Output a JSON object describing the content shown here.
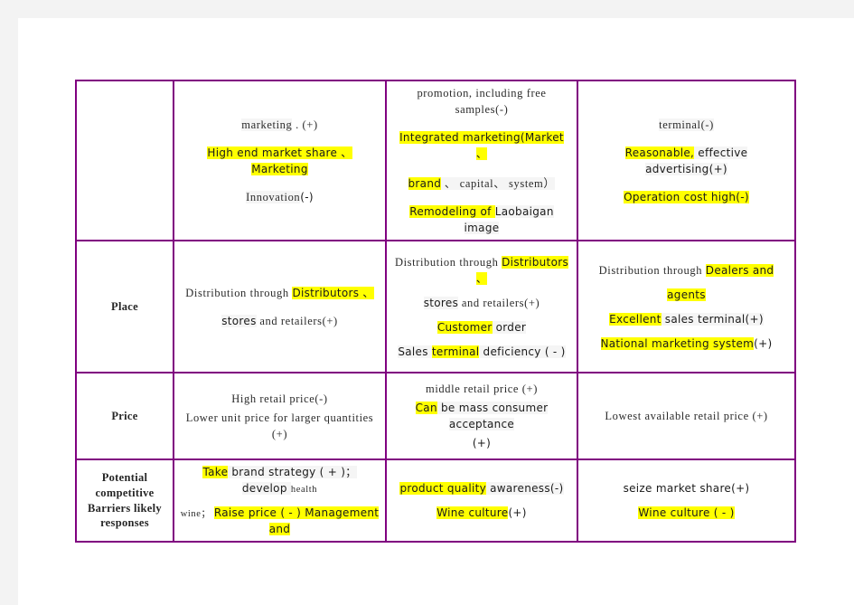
{
  "document": {
    "type": "marketing-mix-comparison-matrix",
    "border_color": "#800080",
    "highlight_color": "#ffff00",
    "page_background": "#ffffff",
    "margin_band_color": "#f3f3f3"
  },
  "table": {
    "row_labels": {
      "r1": "",
      "r2": "Place",
      "r3": "Price",
      "r4": "Potential competitive Barriers likely responses"
    },
    "rows": [
      {
        "label": "",
        "label_lines": [],
        "col1": {
          "lines": [
            [
              {
                "t": "marketing",
                "hl": false,
                "f": "serif",
                "bg": true
              },
              {
                "t": " . (+)",
                "hl": false,
                "f": "serif"
              }
            ],
            [
              {
                "t": "High end market share 、Marketing",
                "hl": true,
                "f": "sans"
              }
            ],
            [
              {
                "t": "Innovation",
                "hl": false,
                "f": "serif",
                "bg": true
              },
              {
                "t": "(-)",
                "hl": false,
                "f": "sans"
              }
            ]
          ]
        },
        "col2": {
          "lines": [
            [
              {
                "t": "promotion, including free samples(-)",
                "hl": false,
                "f": "serif"
              }
            ],
            [
              {
                "t": "Integrated marketing(Market   、",
                "hl": true,
                "f": "sans"
              }
            ],
            [
              {
                "t": "brand",
                "hl": true,
                "f": "sans"
              },
              {
                "t": " 、 capital、 system）",
                "hl": false,
                "f": "serif",
                "bg": true
              }
            ],
            [
              {
                "t": "Remodeling of ",
                "hl": true,
                "f": "sans"
              },
              {
                "t": "Laobaigan image",
                "hl": false,
                "f": "sans",
                "bg": true
              }
            ]
          ]
        },
        "col3": {
          "lines": [
            [
              {
                "t": "terminal(-)",
                "hl": false,
                "f": "serif",
                "bg": true
              }
            ],
            [
              {
                "t": "Reasonable,",
                "hl": true,
                "f": "sans"
              },
              {
                "t": " effective advertising(+)",
                "hl": false,
                "f": "sans",
                "bg": true
              }
            ],
            [
              {
                "t": "Operation cost high(-)",
                "hl": true,
                "f": "sans"
              }
            ]
          ]
        }
      },
      {
        "label": "Place",
        "label_lines": [
          "Place"
        ],
        "col1": {
          "lines": [
            [
              {
                "t": "Distribution through ",
                "hl": false,
                "f": "serif"
              },
              {
                "t": "Distributors  、",
                "hl": true,
                "f": "sans"
              }
            ],
            [
              {
                "t": "stores",
                "hl": false,
                "f": "sans",
                "bg": true
              },
              {
                "t": " and retailers(+)",
                "hl": false,
                "f": "serif"
              }
            ]
          ]
        },
        "col2": {
          "lines": [
            [
              {
                "t": "Distribution through ",
                "hl": false,
                "f": "serif"
              },
              {
                "t": "Distributors  、",
                "hl": true,
                "f": "sans"
              }
            ],
            [
              {
                "t": "stores",
                "hl": false,
                "f": "sans",
                "bg": true
              },
              {
                "t": " and retailers(+)",
                "hl": false,
                "f": "serif"
              }
            ],
            [
              {
                "t": "Customer",
                "hl": true,
                "f": "sans"
              },
              {
                "t": " order",
                "hl": false,
                "f": "sans",
                "bg": true
              }
            ],
            [
              {
                "t": "Sales ",
                "hl": false,
                "f": "sans",
                "bg": true
              },
              {
                "t": "terminal",
                "hl": true,
                "f": "sans"
              },
              {
                "t": " deficiency ( - )",
                "hl": false,
                "f": "sans",
                "bg": true
              }
            ]
          ]
        },
        "col3": {
          "lines": [
            [
              {
                "t": "Distribution through ",
                "hl": false,
                "f": "serif"
              },
              {
                "t": "Dealers and",
                "hl": true,
                "f": "sans"
              }
            ],
            [
              {
                "t": "agents",
                "hl": true,
                "f": "sans"
              }
            ],
            [
              {
                "t": "Excellent",
                "hl": true,
                "f": "sans"
              },
              {
                "t": " sales terminal(+)",
                "hl": false,
                "f": "sans",
                "bg": true
              }
            ],
            [
              {
                "t": "National marketing system",
                "hl": true,
                "f": "sans"
              },
              {
                "t": "(+)",
                "hl": false,
                "f": "sans"
              }
            ]
          ]
        }
      },
      {
        "label": "Price",
        "label_lines": [
          "Price"
        ],
        "col1": {
          "lines": [
            [
              {
                "t": "High retail price(-)",
                "hl": false,
                "f": "serif"
              }
            ],
            [
              {
                "t": "Lower unit price for larger quantities (+)",
                "hl": false,
                "f": "serif"
              }
            ]
          ]
        },
        "col2": {
          "lines": [
            [
              {
                "t": "middle retail price (+)",
                "hl": false,
                "f": "serif"
              }
            ],
            [
              {
                "t": "Can",
                "hl": true,
                "f": "sans"
              },
              {
                "t": " be mass consumer acceptance",
                "hl": false,
                "f": "sans",
                "bg": true
              }
            ],
            [
              {
                "t": "(+)",
                "hl": false,
                "f": "sans"
              }
            ]
          ]
        },
        "col3": {
          "lines": [
            [
              {
                "t": "Lowest available retail price (+)",
                "hl": false,
                "f": "serif"
              }
            ]
          ]
        }
      },
      {
        "label": "Potential competitive Barriers likely responses",
        "label_lines": [
          "Potential",
          "competitive",
          "Barriers likely",
          "responses"
        ],
        "col1": {
          "lines": [
            [
              {
                "t": "Take",
                "hl": true,
                "f": "sans"
              },
              {
                "t": " brand strategy ( + )； develop ",
                "hl": false,
                "f": "sans",
                "bg": true
              },
              {
                "t": "health",
                "hl": false,
                "f": "serif",
                "small": true
              }
            ],
            [
              {
                "t": "wine； ",
                "hl": false,
                "f": "serif",
                "small": true
              },
              {
                "t": "Raise price ( - ) Management and",
                "hl": true,
                "f": "sans"
              }
            ]
          ]
        },
        "col2": {
          "lines": [
            [
              {
                "t": "product quality",
                "hl": true,
                "f": "sans"
              },
              {
                "t": " awareness(-)",
                "hl": false,
                "f": "sans",
                "bg": true
              }
            ],
            [
              {
                "t": "Wine culture",
                "hl": true,
                "f": "sans"
              },
              {
                "t": "(+)",
                "hl": false,
                "f": "sans"
              }
            ]
          ]
        },
        "col3": {
          "lines": [
            [
              {
                "t": "seize market share(+)",
                "hl": false,
                "f": "sans"
              }
            ],
            [
              {
                "t": "Wine culture ( - )",
                "hl": true,
                "f": "sans"
              }
            ]
          ]
        }
      }
    ]
  }
}
